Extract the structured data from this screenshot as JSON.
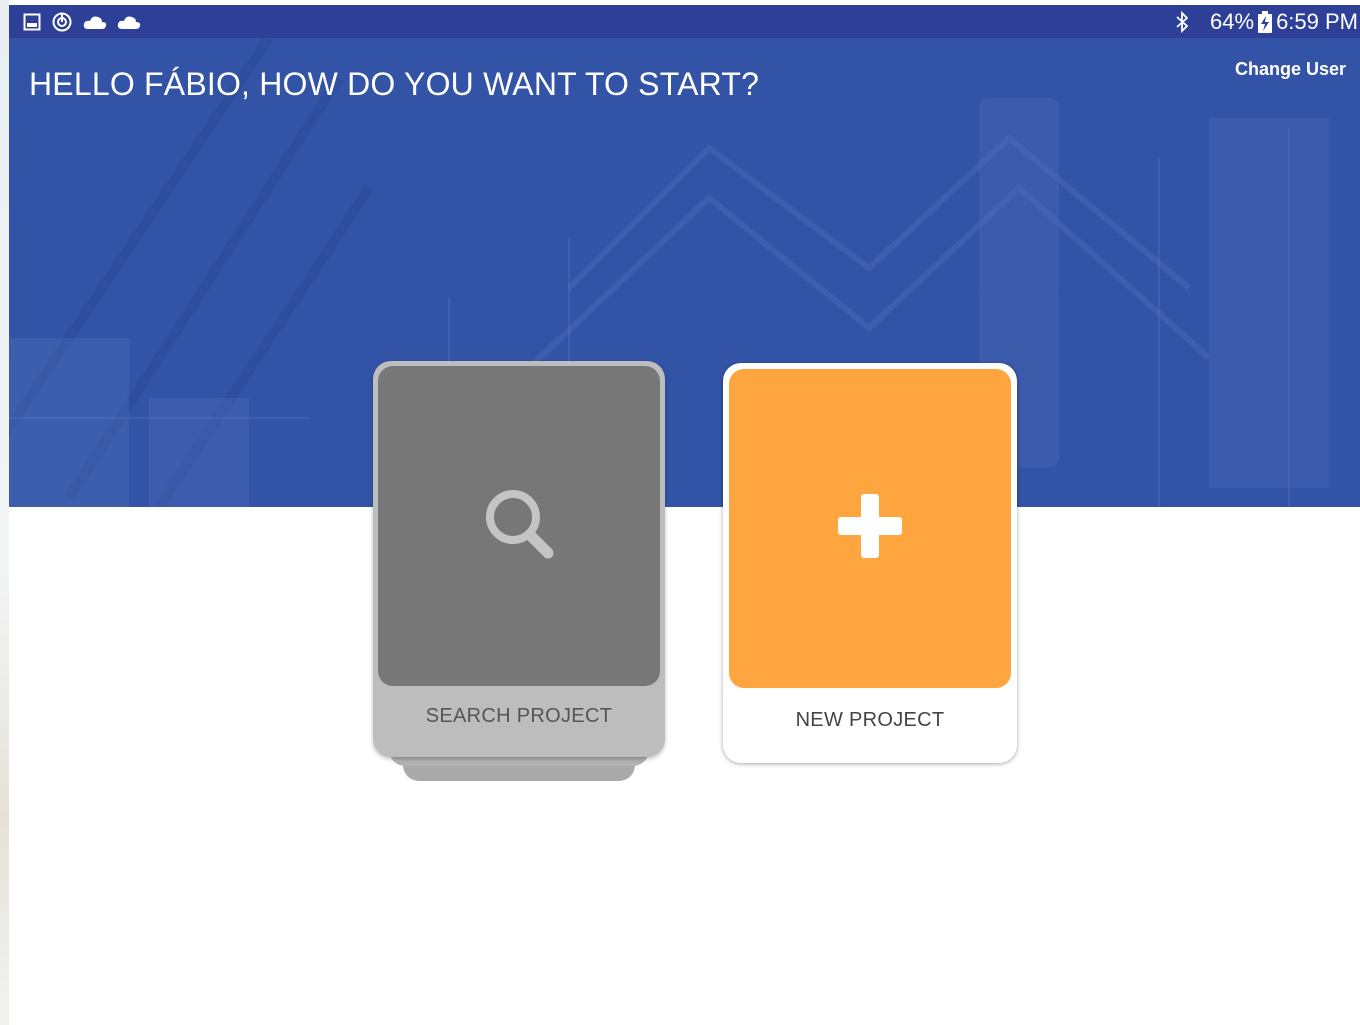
{
  "status_bar": {
    "left_icons": [
      "gallery-icon",
      "sync-icon",
      "cloud-icon",
      "cloud-icon"
    ],
    "bluetooth_icon": "bluetooth-icon",
    "battery_percent": "64%",
    "battery_icon": "battery-charging-icon",
    "time": "6:59 PM"
  },
  "header": {
    "greeting": "HELLO FÁBIO, HOW DO YOU WANT TO START?",
    "change_user_label": "Change User"
  },
  "cards": {
    "search": {
      "label": "SEARCH PROJECT",
      "icon": "search-icon"
    },
    "new": {
      "label": "NEW PROJECT",
      "icon": "plus-icon"
    }
  },
  "colors": {
    "status_bar": "#2e3f98",
    "hero": "#3353a6",
    "search_tile": "#777777",
    "search_card": "#bdbdbd",
    "new_tile": "#ffa53f"
  }
}
